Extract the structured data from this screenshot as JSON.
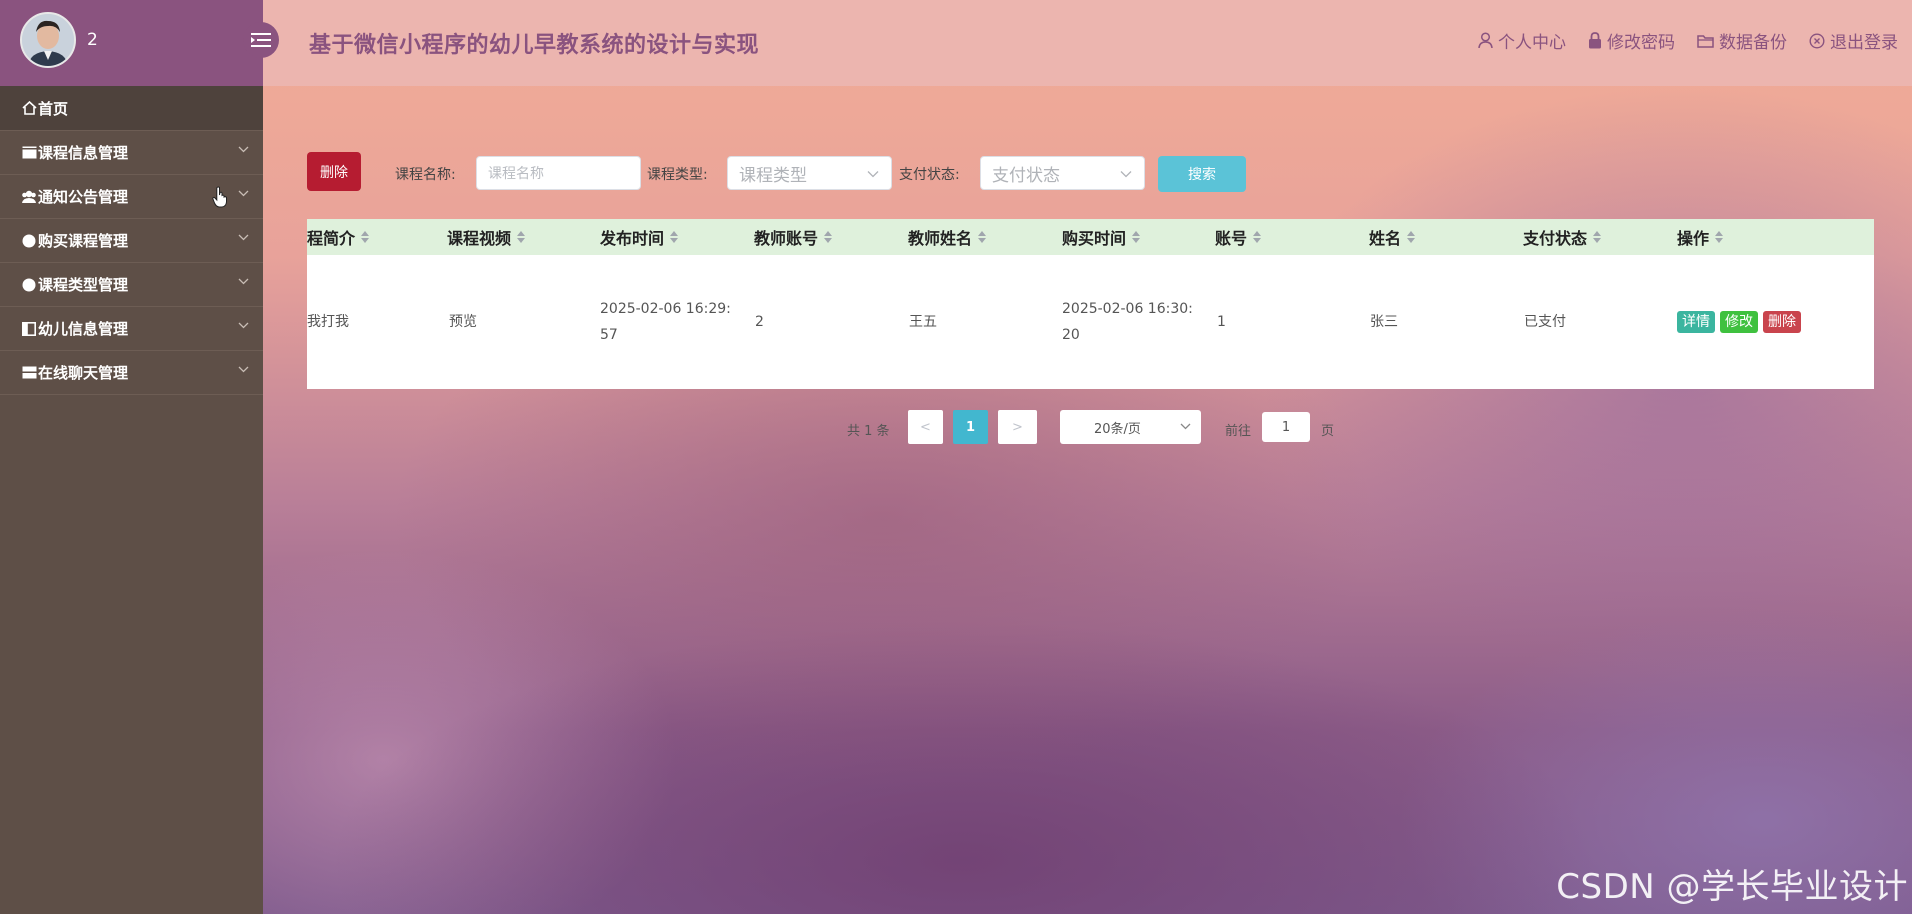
{
  "user": {
    "name": "2"
  },
  "app": {
    "title": "基于微信小程序的幼儿早教系统的设计与实现"
  },
  "topbar": {
    "links": [
      {
        "label": "个人中心",
        "icon": "user-icon"
      },
      {
        "label": "修改密码",
        "icon": "lock-icon"
      },
      {
        "label": "数据备份",
        "icon": "folder-icon"
      },
      {
        "label": "退出登录",
        "icon": "close-circle-icon"
      }
    ]
  },
  "sidebar": {
    "items": [
      {
        "label": "首页",
        "icon": "home-icon"
      },
      {
        "label": "课程信息管理",
        "icon": "card-icon"
      },
      {
        "label": "通知公告管理",
        "icon": "group-icon"
      },
      {
        "label": "购买课程管理",
        "icon": "circle-icon"
      },
      {
        "label": "课程类型管理",
        "icon": "circle-icon"
      },
      {
        "label": "幼儿信息管理",
        "icon": "square-icon"
      },
      {
        "label": "在线聊天管理",
        "icon": "card-icon"
      }
    ]
  },
  "toolbar": {
    "delete_label": "删除",
    "course_name_label": "课程名称:",
    "course_name_placeholder": "课程名称",
    "course_type_label": "课程类型:",
    "course_type_placeholder": "课程类型",
    "pay_status_label": "支付状态:",
    "pay_status_placeholder": "支付状态",
    "search_label": "搜索"
  },
  "table": {
    "columns": [
      "程简介",
      "课程视频",
      "发布时间",
      "教师账号",
      "教师姓名",
      "购买时间",
      "账号",
      "姓名",
      "支付状态",
      "操作"
    ],
    "rows": [
      {
        "intro": "我打我",
        "video": "预览",
        "publish_time_1": "2025-02-06 16:29:",
        "publish_time_2": "57",
        "teacher_account": "2",
        "teacher_name": "王五",
        "buy_time_1": "2025-02-06 16:30:",
        "buy_time_2": "20",
        "account": "1",
        "name": "张三",
        "pay_status": "已支付",
        "actions": {
          "detail": "详情",
          "edit": "修改",
          "delete": "删除"
        }
      }
    ]
  },
  "pagination": {
    "total": "共 1 条",
    "prev": "<",
    "current": "1",
    "next": ">",
    "page_size": "20条/页",
    "goto_label": "前往",
    "goto_value": "1",
    "page_suffix": "页"
  },
  "watermark": "CSDN @学长毕业设计",
  "colors": {
    "sidebar_bg": "#5e4f47",
    "sidebar_top": "#8a537f",
    "accent": "#8a537f",
    "delete": "#b61c31",
    "search": "#5bc3d7",
    "table_header": "#dff1dc"
  }
}
